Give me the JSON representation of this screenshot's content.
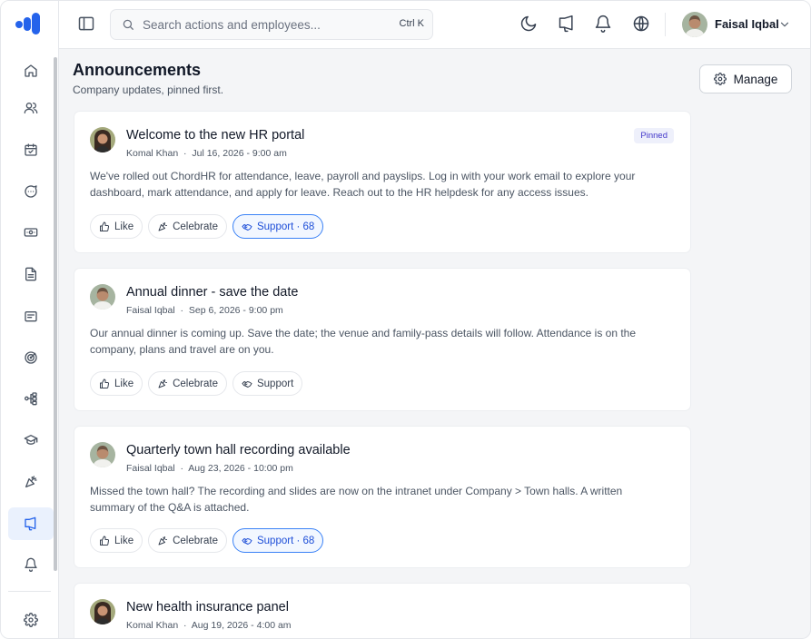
{
  "search": {
    "placeholder": "Search actions and employees...",
    "shortcut": "Ctrl K"
  },
  "user": {
    "name": "Faisal Iqbal"
  },
  "page": {
    "title": "Announcements",
    "subtitle": "Company updates, pinned first."
  },
  "manage_label": "Manage",
  "nav": [
    "home-icon",
    "people-icon",
    "calendar-icon",
    "chat-icon",
    "money-icon",
    "document-icon",
    "message-icon",
    "target-icon",
    "org-chart-icon",
    "graduation-cap-icon",
    "party-icon",
    "megaphone-icon",
    "bell-icon",
    "settings-icon"
  ],
  "active_nav": "megaphone-icon",
  "announcements": [
    {
      "title": "Welcome to the new HR portal",
      "author": "Komal Khan",
      "date": "Jul 16, 2026 - 9:00 am",
      "badge": "Pinned",
      "body": "We've rolled out ChordHR for attendance, leave, payroll and payslips. Log in with your work email to explore your dashboard, mark attendance, and apply for leave. Reach out to the HR helpdesk for any access issues.",
      "like": "Like",
      "celebrate": "Celebrate",
      "support": "Support · 68"
    },
    {
      "title": "Annual dinner - save the date",
      "author": "Faisal Iqbal",
      "date": "Sep 6, 2026 - 9:00 pm",
      "body": "Our annual dinner is coming up. Save the date; the venue and family-pass details will follow. Attendance is on the company, plans and travel are on you.",
      "like": "Like",
      "celebrate": "Celebrate",
      "support": "Support"
    },
    {
      "title": "Quarterly town hall recording available",
      "author": "Faisal Iqbal",
      "date": "Aug 23, 2026 - 10:00 pm",
      "body": "Missed the town hall? The recording and slides are now on the intranet under Company > Town halls. A written summary of the Q&A is attached.",
      "like": "Like",
      "celebrate": "Celebrate",
      "support": "Support · 68"
    },
    {
      "title": "New health insurance panel",
      "author": "Komal Khan",
      "date": "Aug 19, 2026 - 4:00 am"
    }
  ],
  "colors": {
    "accent": "#2563eb",
    "pinned_text": "#4338ca",
    "background": "#f4f5f7"
  }
}
